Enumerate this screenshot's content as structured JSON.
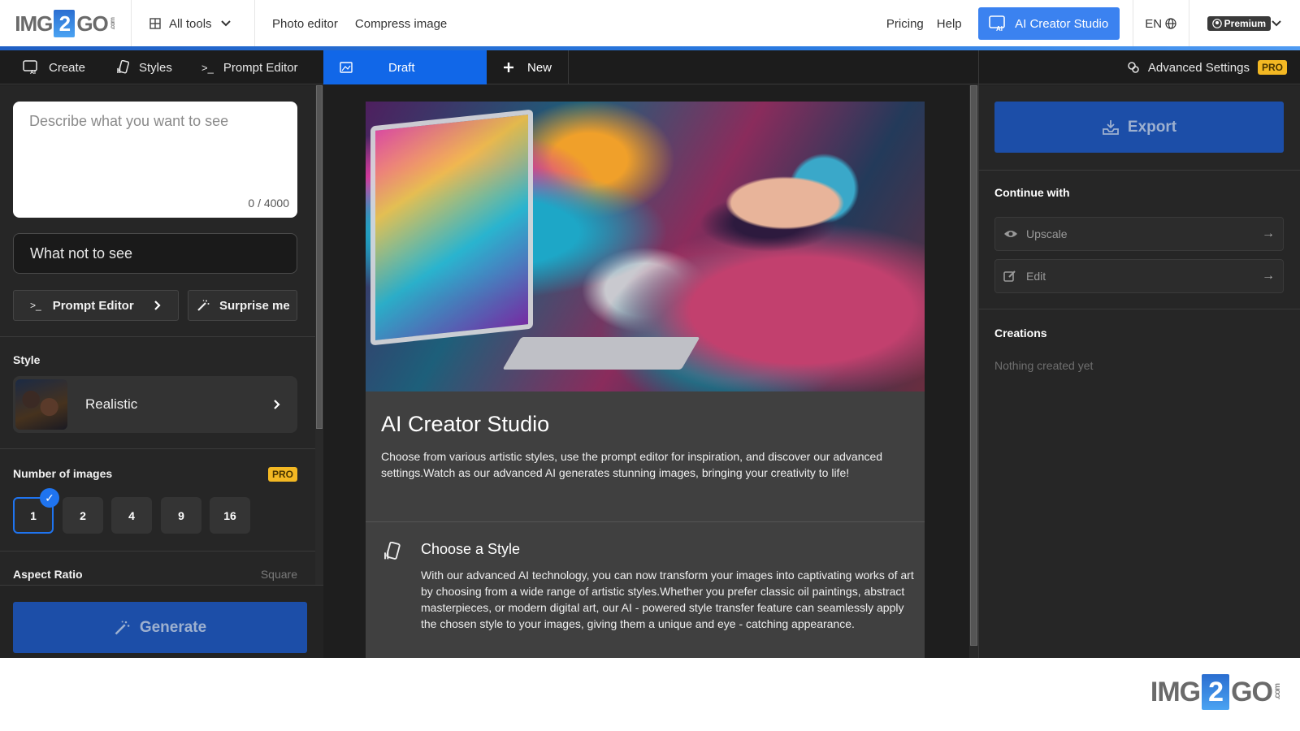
{
  "header": {
    "logo": {
      "part1": "IMG",
      "part2": "2",
      "part3": "GO",
      "suffix": ".com"
    },
    "all_tools_label": "All tools",
    "nav_links": [
      "Photo editor",
      "Compress image"
    ],
    "pricing_label": "Pricing",
    "help_label": "Help",
    "ai_studio_label": "AI Creator Studio",
    "language": "EN",
    "premium_label": "Premium"
  },
  "tabs": {
    "left": [
      {
        "label": "Create",
        "icon": "ai-image-icon"
      },
      {
        "label": "Styles",
        "icon": "styles-icon"
      },
      {
        "label": "Prompt Editor",
        "icon": "terminal-icon"
      }
    ],
    "draft_label": "Draft",
    "new_label": "New",
    "advanced_settings_label": "Advanced Settings",
    "pro_badge": "PRO"
  },
  "left_panel": {
    "prompt_placeholder": "Describe what you want to see",
    "prompt_value": "",
    "char_count": "0 / 4000",
    "negative_placeholder": "What not to see",
    "prompt_editor_button": "Prompt Editor",
    "surprise_button": "Surprise me",
    "style_section_title": "Style",
    "style_selected": "Realistic",
    "number_section_title": "Number of images",
    "number_pro_badge": "PRO",
    "number_options": [
      "1",
      "2",
      "4",
      "9",
      "16"
    ],
    "number_selected": "1",
    "aspect_ratio_title": "Aspect Ratio",
    "aspect_ratio_value": "Square",
    "generate_button": "Generate"
  },
  "center": {
    "title": "AI Creator Studio",
    "description": "Choose from various artistic styles, use the prompt editor for inspiration, and discover our advanced settings.Watch as our advanced AI generates stunning images, bringing your creativity to life!",
    "feature_title": "Choose a Style",
    "feature_description": "With our advanced AI technology, you can now transform your images into captivating works of art by choosing from a wide range of artistic styles.Whether you prefer classic oil paintings, abstract masterpieces, or modern digital art, our AI - powered style transfer feature can seamlessly apply the chosen style to your images, giving them a unique and eye - catching appearance."
  },
  "right_panel": {
    "export_button": "Export",
    "continue_title": "Continue with",
    "continue_items": [
      {
        "label": "Upscale",
        "icon": "eye-icon"
      },
      {
        "label": "Edit",
        "icon": "edit-icon"
      }
    ],
    "creations_title": "Creations",
    "creations_empty": "Nothing created yet"
  },
  "colors": {
    "accent": "#1167e8",
    "primary_button": "#1c4ea8",
    "pro_badge": "#f3b823",
    "panel_bg": "#262626"
  }
}
